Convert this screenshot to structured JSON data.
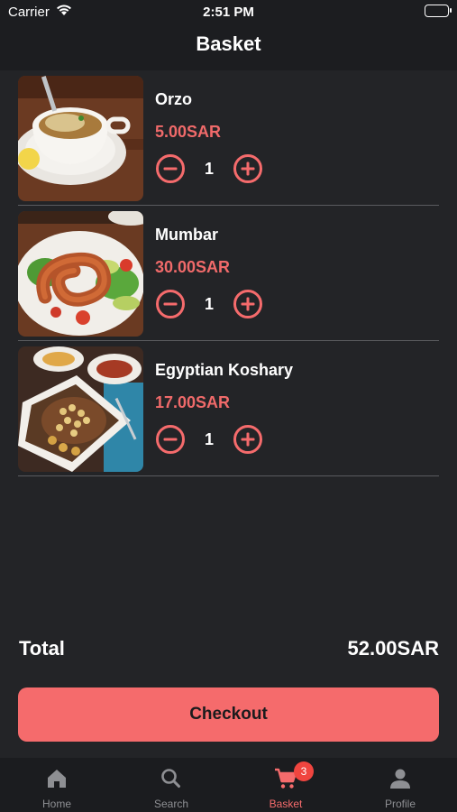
{
  "status_bar": {
    "carrier": "Carrier",
    "time": "2:51 PM"
  },
  "header": {
    "title": "Basket"
  },
  "items": [
    {
      "name": "Orzo",
      "price": "5.00SAR",
      "quantity": "1"
    },
    {
      "name": "Mumbar",
      "price": "30.00SAR",
      "quantity": "1"
    },
    {
      "name": "Egyptian Koshary",
      "price": "17.00SAR",
      "quantity": "1"
    }
  ],
  "summary": {
    "total_label": "Total",
    "total_value": "52.00SAR"
  },
  "checkout_label": "Checkout",
  "tabbar": {
    "tabs": [
      {
        "label": "Home",
        "icon": "home-icon"
      },
      {
        "label": "Search",
        "icon": "search-icon"
      },
      {
        "label": "Basket",
        "icon": "cart-icon",
        "badge": "3",
        "active": true
      },
      {
        "label": "Profile",
        "icon": "profile-icon"
      }
    ]
  },
  "colors": {
    "accent": "#f56b6c",
    "background": "#232427",
    "price": "#f06a6a"
  }
}
